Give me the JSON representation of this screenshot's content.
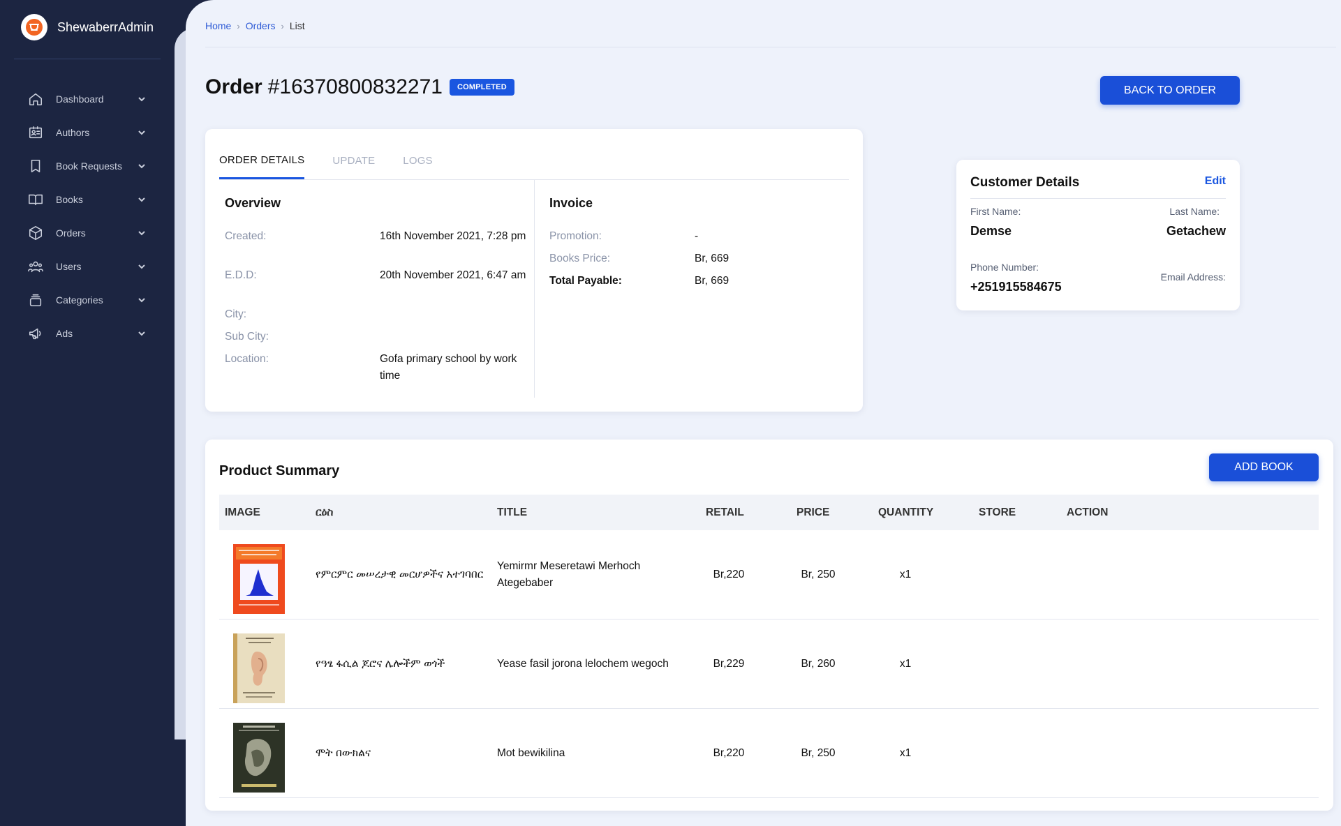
{
  "sidebar": {
    "brand": "ShewaberrAdmin",
    "items": [
      {
        "label": "Dashboard",
        "icon": "home-icon"
      },
      {
        "label": "Authors",
        "icon": "id-card-icon"
      },
      {
        "label": "Book Requests",
        "icon": "bookmark-icon"
      },
      {
        "label": "Books",
        "icon": "open-book-icon"
      },
      {
        "label": "Orders",
        "icon": "box-icon"
      },
      {
        "label": "Users",
        "icon": "users-icon"
      },
      {
        "label": "Categories",
        "icon": "layers-icon"
      },
      {
        "label": "Ads",
        "icon": "megaphone-icon"
      }
    ]
  },
  "breadcrumb": {
    "home": "Home",
    "orders": "Orders",
    "current": "List"
  },
  "order": {
    "title_prefix": "Order",
    "number": "#16370800832271",
    "status": "COMPLETED",
    "back_button": "BACK TO ORDER"
  },
  "tabs": {
    "details": "ORDER DETAILS",
    "update": "UPDATE",
    "logs": "LOGS"
  },
  "overview": {
    "title": "Overview",
    "created_label": "Created:",
    "created_value": "16th November 2021, 7:28 pm",
    "edd_label": "E.D.D:",
    "edd_value": "20th November 2021, 6:47 am",
    "city_label": "City:",
    "subcity_label": "Sub City:",
    "location_label": "Location:",
    "location_value": "Gofa primary school by work time"
  },
  "invoice": {
    "title": "Invoice",
    "promotion_label": "Promotion:",
    "promotion_value": "-",
    "books_price_label": "Books Price:",
    "books_price_value": "Br, 669",
    "total_label": "Total Payable:",
    "total_value": "Br, 669"
  },
  "customer": {
    "title": "Customer Details",
    "edit": "Edit",
    "first_name_label": "First Name:",
    "first_name": "Demse",
    "last_name_label": "Last Name:",
    "last_name": "Getachew",
    "phone_label": "Phone Number:",
    "phone": "+251915584675",
    "email_label": "Email Address:"
  },
  "products": {
    "title": "Product Summary",
    "add_button": "ADD BOOK",
    "columns": [
      "IMAGE",
      "ርዕስ",
      "TITLE",
      "RETAIL",
      "PRICE",
      "QUANTITY",
      "STORE",
      "ACTION"
    ],
    "rows": [
      {
        "amharic": "የምርምር መሠረታዊ መርሆዎችና አተገባበር",
        "title": "Yemirmr Meseretawi Merhoch Ategebaber",
        "retail": "Br,220",
        "price": "Br, 250",
        "quantity": "x1"
      },
      {
        "amharic": "የዓፄ ፋሲል ጆሮና ሌሎችም ወጎች",
        "title": "Yease fasil jorona lelochem wegoch",
        "retail": "Br,229",
        "price": "Br, 260",
        "quantity": "x1"
      },
      {
        "amharic": "ሞት በውክልና",
        "title": "Mot bewikilina",
        "retail": "Br,220",
        "price": "Br, 250",
        "quantity": "x1"
      }
    ]
  },
  "colors": {
    "sidebar_bg": "#1c2541",
    "main_bg": "#eef2fb",
    "accent": "#1a56e0"
  }
}
